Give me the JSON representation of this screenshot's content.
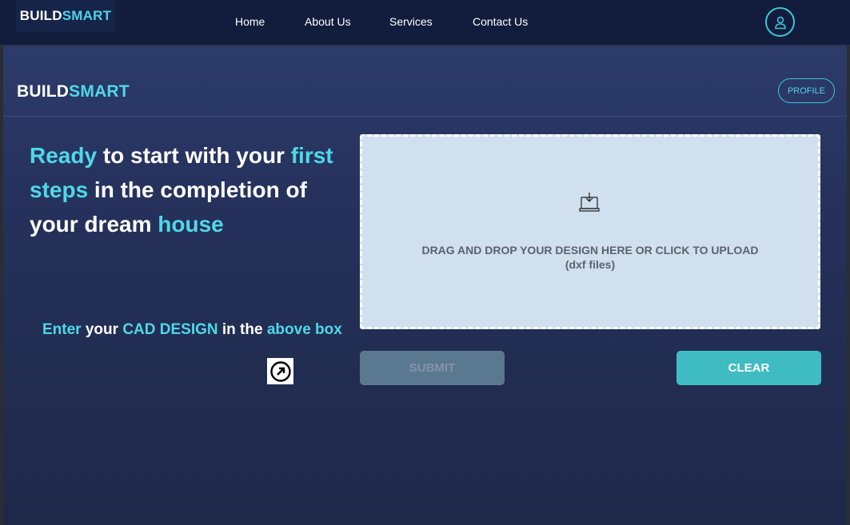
{
  "header": {
    "logo": {
      "part1": "BUILD",
      "part2": "SMART"
    },
    "nav": [
      "Home",
      "About Us",
      "Services",
      "Contact Us"
    ],
    "user_icon": "user-icon"
  },
  "page": {
    "brand": {
      "part1": "BUILD",
      "part2": "SMART"
    },
    "profile_label": "PROFILE",
    "headline": {
      "w1": "Ready",
      "w2": " to start with your ",
      "w3": "first steps",
      "w4": " in the completion of your dream ",
      "w5": "house"
    },
    "hint": {
      "w1": "Enter",
      "w2": " your ",
      "w3": "CAD DESIGN",
      "w4": " in the ",
      "w5": "above box"
    },
    "arrow_icon": "arrow-up-right-circle-icon"
  },
  "upload": {
    "icon": "download-tray-icon",
    "line1": "DRAG AND DROP YOUR DESIGN HERE OR CLICK TO UPLOAD",
    "line2": "(dxf files)"
  },
  "actions": {
    "submit_label": "SUBMIT",
    "clear_label": "CLEAR"
  },
  "colors": {
    "accent": "#4fd8e8",
    "header_bg": "#121d3d",
    "dropzone_bg": "#d1e0ee",
    "clear_bg": "#3fbcc2",
    "submit_bg": "#5a7890"
  }
}
